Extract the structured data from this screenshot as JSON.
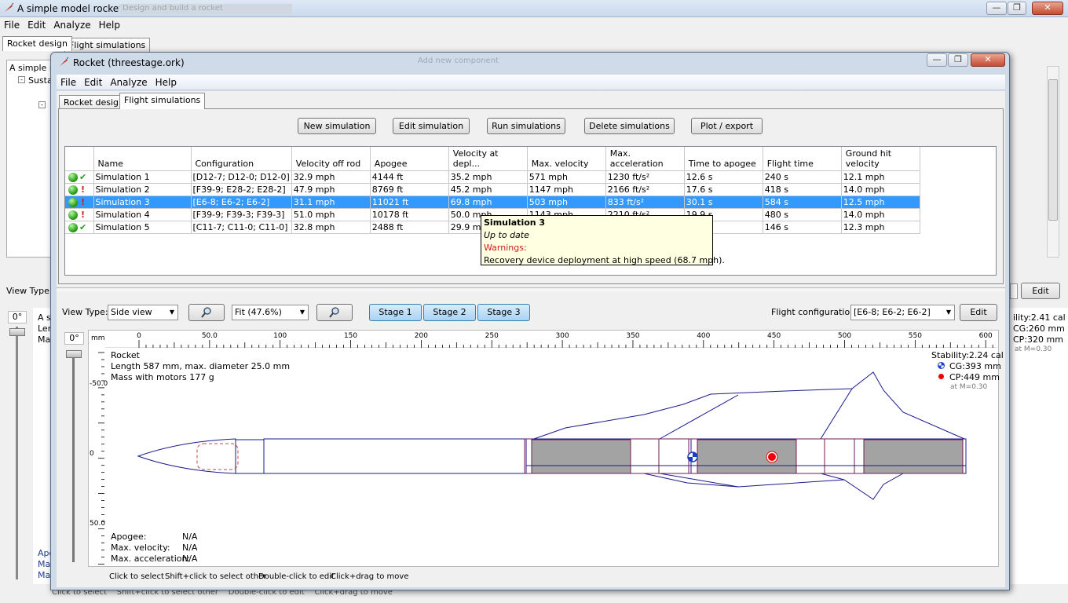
{
  "bg_window": {
    "title": "A simple model rocket",
    "title_ghost": "Design and build a rocket",
    "menu": [
      "File",
      "Edit",
      "Analyze",
      "Help"
    ],
    "tabs": [
      "Rocket design",
      "Flight simulations"
    ],
    "tree_root": "A simple mo",
    "tree_child": "Susta",
    "view_type_label": "View Type:",
    "angle": "0°",
    "edit_button": "Edit",
    "stability": "ility:2.41 cal",
    "cg": "CG:260 mm",
    "cp": "CP:320 mm",
    "mach": "at M=0.30",
    "side_text": [
      "A s",
      "Len",
      "Ma"
    ],
    "bottom_side": [
      "Apo",
      "Ma",
      "Ma"
    ],
    "hint": "Click to select    Shift+click to select other    Double-click to edit    Click+drag to move"
  },
  "dialog": {
    "title": "Rocket (threestage.ork)",
    "ghost_title": "Add new component",
    "menu": [
      "File",
      "Edit",
      "Analyze",
      "Help"
    ],
    "tabs": [
      "Rocket design",
      "Flight simulations"
    ],
    "toolbar": [
      "New simulation",
      "Edit simulation",
      "Run simulations",
      "Delete simulations",
      "Plot / export"
    ],
    "columns": [
      "Name",
      "Configuration",
      "Velocity off rod",
      "Apogee",
      "Velocity at depl...",
      "Max. velocity",
      "Max. acceleration",
      "Time to apogee",
      "Flight time",
      "Ground hit velocity"
    ],
    "rows": [
      {
        "status": "ok",
        "cells": [
          "Simulation 1",
          "[D12-7; D12-0; D12-0]",
          "32.9 mph",
          "4144 ft",
          "35.2 mph",
          "571 mph",
          "1230 ft/s²",
          "12.6 s",
          "240 s",
          "12.1 mph"
        ]
      },
      {
        "status": "warn",
        "cells": [
          "Simulation 2",
          "[F39-9; E28-2; E28-2]",
          "47.9 mph",
          "8769 ft",
          "45.2 mph",
          "1147 mph",
          "2166 ft/s²",
          "17.6 s",
          "418 s",
          "14.0 mph"
        ]
      },
      {
        "status": "warn",
        "cells": [
          "Simulation 3",
          "[E6-8; E6-2; E6-2]",
          "31.1 mph",
          "11021 ft",
          "69.8 mph",
          "503 mph",
          "833 ft/s²",
          "30.1 s",
          "584 s",
          "12.5 mph"
        ]
      },
      {
        "status": "warn",
        "cells": [
          "Simulation 4",
          "[F39-9; F39-3; F39-3]",
          "51.0 mph",
          "10178 ft",
          "50.0 mph",
          "1143 mph",
          "2210 ft/s²",
          "19.9 s",
          "480 s",
          "14.0 mph"
        ]
      },
      {
        "status": "ok",
        "cells": [
          "Simulation 5",
          "[C11-7; C11-0; C11-0]",
          "32.8 mph",
          "2488 ft",
          "29.9 mph",
          "",
          "",
          "",
          "146 s",
          "12.3 mph"
        ]
      }
    ],
    "selected_row": 2,
    "tooltip": {
      "title": "Simulation 3",
      "status": "Up to date",
      "warnings_label": "Warnings:",
      "warning": "Recovery device deployment at high speed (68.7 mph)."
    },
    "view": {
      "view_type_label": "View Type:",
      "view_type": "Side view",
      "zoom": "Fit (47.6%)",
      "stages": [
        "Stage 1",
        "Stage 2",
        "Stage 3"
      ],
      "flight_config_label": "Flight configuration:",
      "flight_config": "[E6-8; E6-2; E6-2]",
      "edit": "Edit",
      "angle": "0°",
      "unit": "mm",
      "ruler_ticks": [
        "0",
        "50.0",
        "100",
        "150",
        "200",
        "250",
        "300",
        "350",
        "400",
        "450",
        "500",
        "550",
        "600"
      ],
      "v_ticks": [
        "-50.0",
        "0",
        "50.0"
      ],
      "rocket_name": "Rocket",
      "rocket_length": "Length 587 mm, max. diameter 25.0 mm",
      "rocket_mass": "Mass with motors 177 g",
      "stability": "Stability:2.24 cal",
      "cg": "CG:393 mm",
      "cp": "CP:449 mm",
      "mach": "at M=0.30",
      "apogee_label": "Apogee:",
      "apogee": "N/A",
      "maxvel_label": "Max. velocity:",
      "maxvel": "N/A",
      "maxacc_label": "Max. acceleration:",
      "maxacc": "N/A",
      "hints": [
        "Click to select",
        "Shift+click to select other",
        "Double-click to edit",
        "Click+drag to move"
      ]
    }
  }
}
